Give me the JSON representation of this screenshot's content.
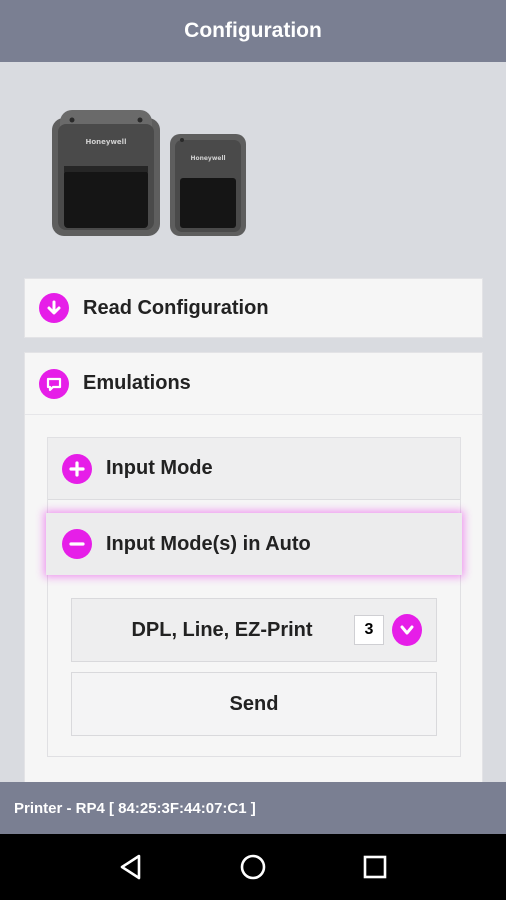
{
  "header": {
    "title": "Configuration"
  },
  "image": {
    "brand_left": "Honeywell",
    "brand_right": "Honeywell"
  },
  "sections": {
    "read_configuration": {
      "label": "Read Configuration",
      "icon": "download-circle-icon"
    },
    "emulations": {
      "label": "Emulations",
      "icon": "chat-bubble-icon",
      "input_mode": {
        "label": "Input Mode",
        "icon": "plus-circle-icon"
      },
      "input_mode_auto": {
        "label": "Input Mode(s) in Auto",
        "icon": "minus-circle-icon",
        "selected_value": "DPL, Line, EZ-Print",
        "count": "3",
        "send_label": "Send"
      }
    }
  },
  "status": {
    "printer_text": "Printer - RP4 [ 84:25:3F:44:07:C1 ]"
  },
  "colors": {
    "accent": "#e61ee8",
    "header_bg": "#7a7f92",
    "page_bg": "#d9dbe0"
  }
}
